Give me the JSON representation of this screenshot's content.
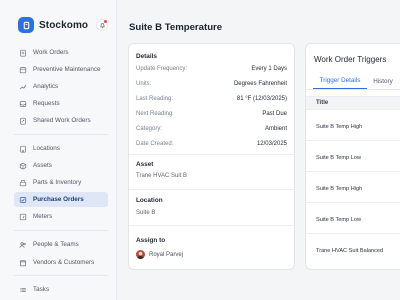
{
  "brand": {
    "name": "Stockomo"
  },
  "sidebar": {
    "items": [
      {
        "label": "Work Orders"
      },
      {
        "label": "Preventive Maintenance"
      },
      {
        "label": "Analytics"
      },
      {
        "label": "Requests"
      },
      {
        "label": "Shared Work Orders"
      },
      {
        "label": "Locations"
      },
      {
        "label": "Assets"
      },
      {
        "label": "Parts & Inventory"
      },
      {
        "label": "Purchase Orders",
        "active": true
      },
      {
        "label": "Meters"
      },
      {
        "label": "People & Teams"
      },
      {
        "label": "Vendors & Customers"
      },
      {
        "label": "Tasks"
      }
    ]
  },
  "main": {
    "title": "Suite B Temperature",
    "details": {
      "title": "Details",
      "rows": [
        {
          "label": "Update Frequency:",
          "value": "Every 1 Days"
        },
        {
          "label": "Units:",
          "value": "Degrees Fahrenheit"
        },
        {
          "label": "Last Reading:",
          "value": "81 °F (12/03/2025)"
        },
        {
          "label": "Next Reading",
          "value": "Past Due"
        },
        {
          "label": "Category:",
          "value": "Ambient"
        },
        {
          "label": "Date Created:",
          "value": "12/03/2025"
        }
      ],
      "asset_title": "Asset",
      "asset_value": "Trane HVAC Suit B",
      "location_title": "Location",
      "location_value": "Suite B",
      "assign_title": "Assign to",
      "assignee": "Royal Parvej"
    },
    "triggers": {
      "title": "Work Order Triggers",
      "tabs": [
        "Trigger Details",
        "History"
      ],
      "column": "Title",
      "rows": [
        "Suite B Temp High",
        "Suite B Temp Low",
        "Suite B Temp High",
        "Suite B Temp Low",
        "Trane HVAC Suit Balanced"
      ]
    }
  },
  "colors": {
    "accent": "#2f6fe4",
    "active_bg": "#dfe7f6",
    "sidebar_bg": "#f7f8fa"
  }
}
